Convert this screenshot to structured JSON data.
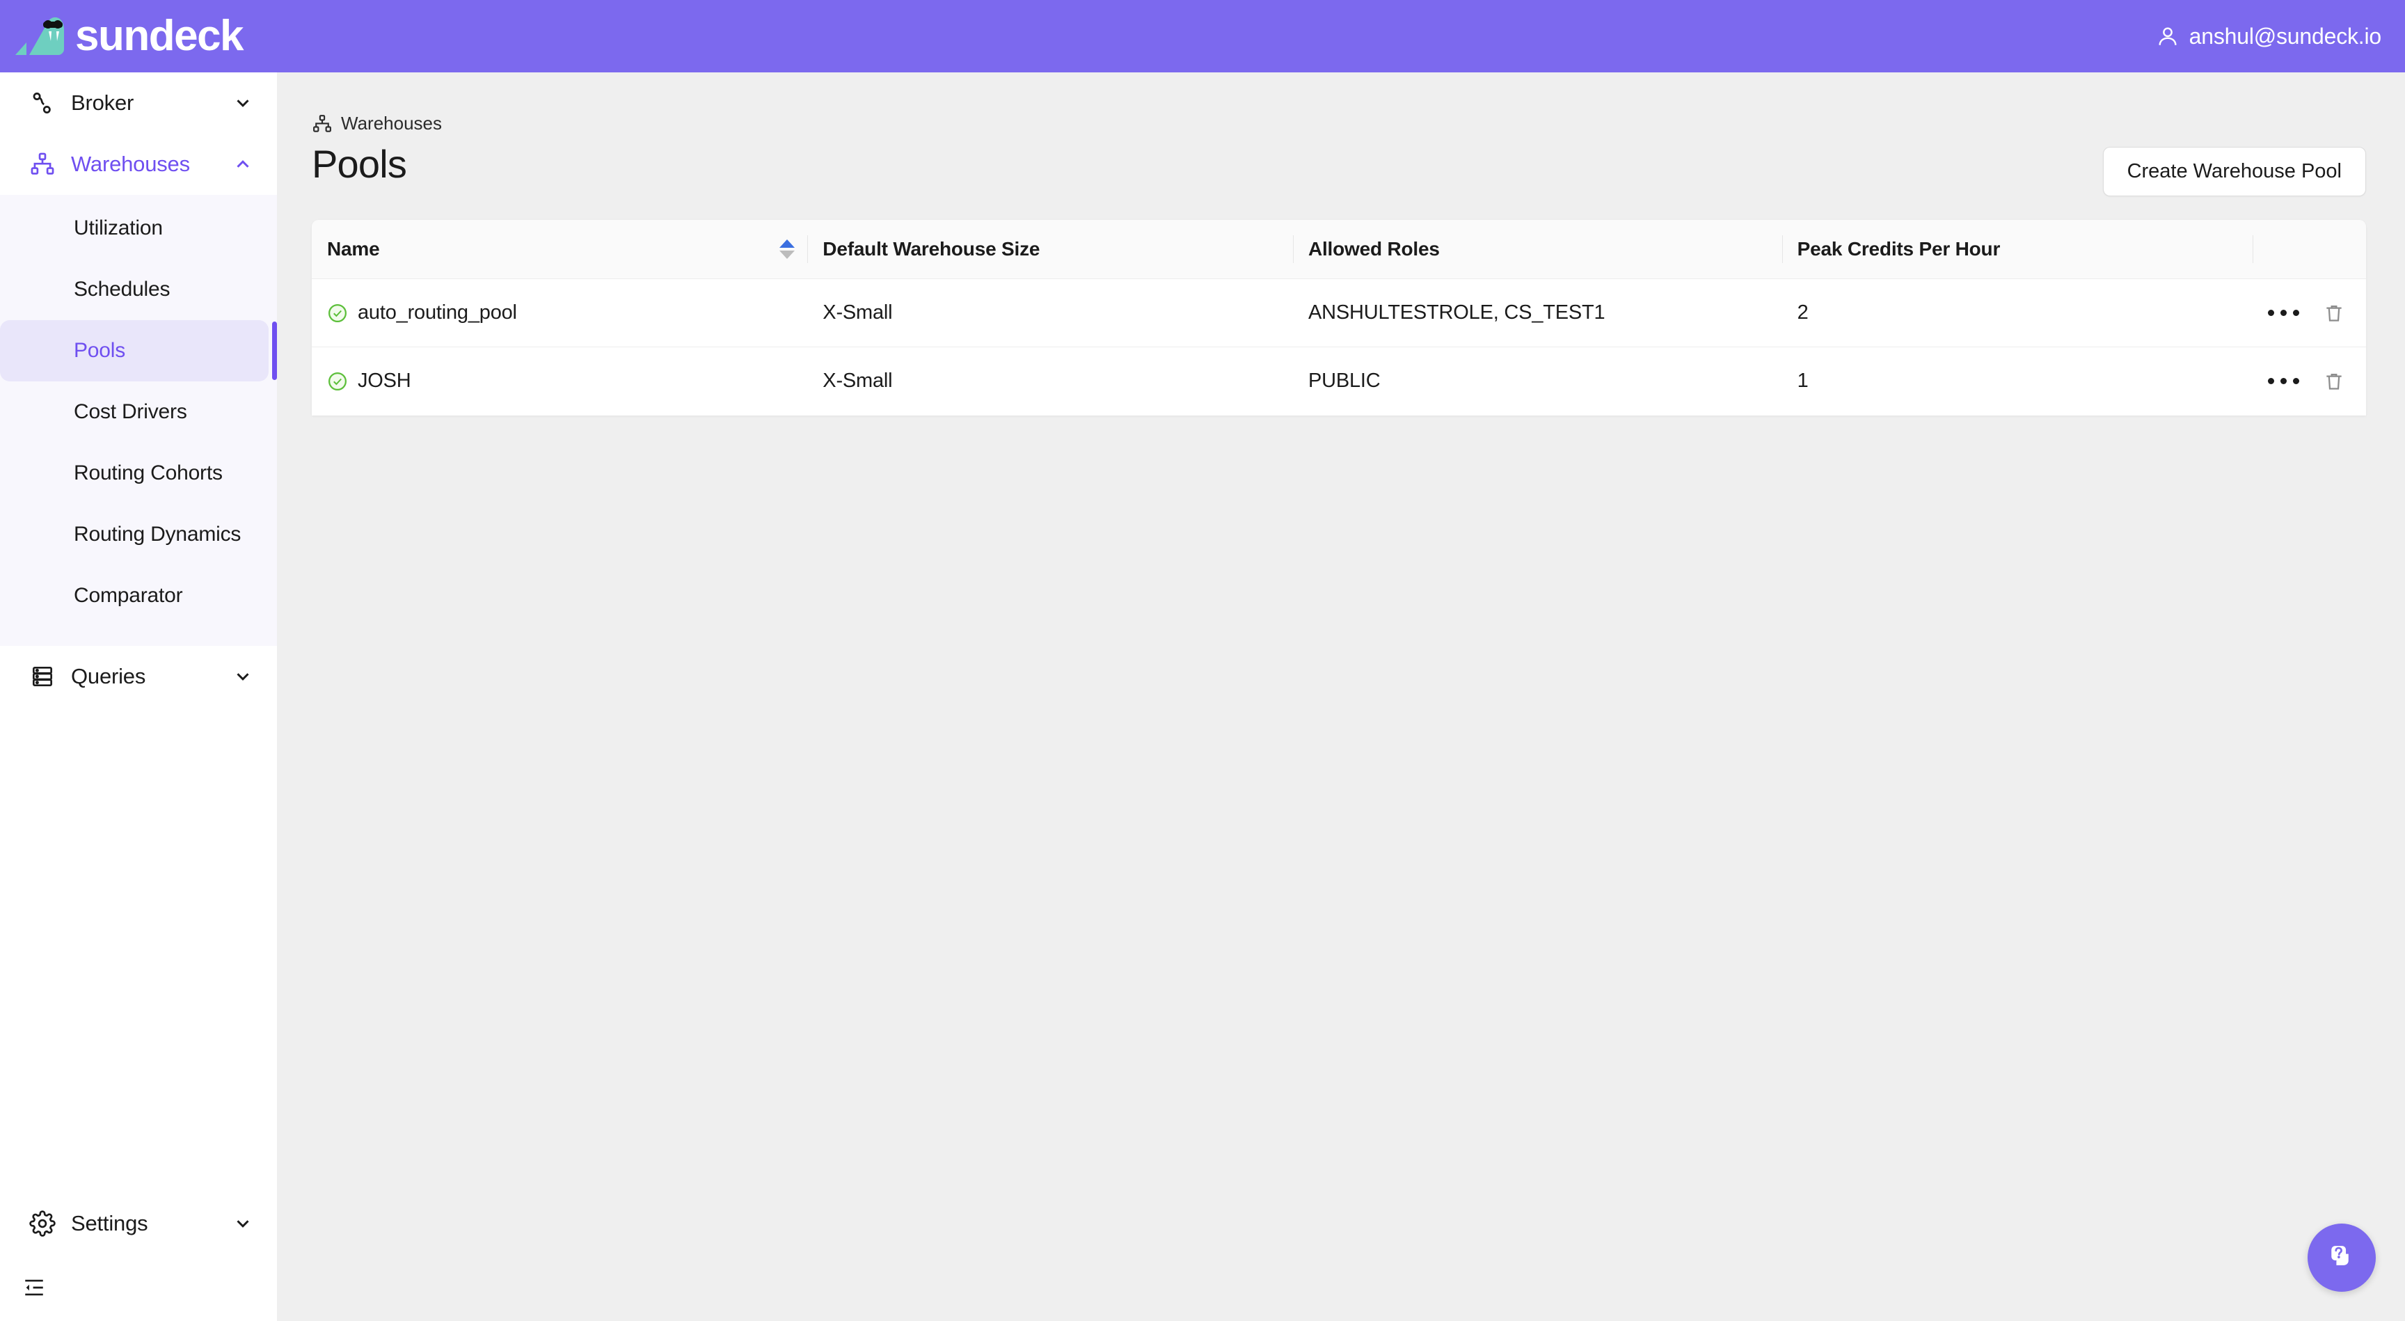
{
  "topbar": {
    "brand_name": "sundeck",
    "logo_icon": "walrus-sunglasses-logo",
    "user_icon": "person-icon",
    "user_email": "anshul@sundeck.io"
  },
  "sidebar": {
    "groups": [
      {
        "label": "Broker",
        "icon": "route-nodes-icon",
        "expanded": false,
        "active": false,
        "items": []
      },
      {
        "label": "Warehouses",
        "icon": "hierarchy-icon",
        "expanded": true,
        "active": true,
        "items": [
          {
            "label": "Utilization",
            "selected": false
          },
          {
            "label": "Schedules",
            "selected": false
          },
          {
            "label": "Pools",
            "selected": true
          },
          {
            "label": "Cost Drivers",
            "selected": false
          },
          {
            "label": "Routing Cohorts",
            "selected": false
          },
          {
            "label": "Routing Dynamics",
            "selected": false
          },
          {
            "label": "Comparator",
            "selected": false
          }
        ]
      },
      {
        "label": "Queries",
        "icon": "server-rack-icon",
        "expanded": false,
        "active": false,
        "items": []
      }
    ],
    "settings": {
      "label": "Settings",
      "icon": "gear-icon"
    },
    "collapse_icon": "collapse-sidebar-icon"
  },
  "main": {
    "breadcrumb": "Warehouses",
    "breadcrumb_icon": "hierarchy-icon",
    "page_title": "Pools",
    "create_button": "Create Warehouse Pool"
  },
  "table": {
    "columns": [
      {
        "label": "Name",
        "sorted": "asc"
      },
      {
        "label": "Default Warehouse Size",
        "sorted": null
      },
      {
        "label": "Allowed Roles",
        "sorted": null
      },
      {
        "label": "Peak Credits Per Hour",
        "sorted": null
      },
      {
        "label": "",
        "sorted": null
      }
    ],
    "rows": [
      {
        "status_icon": "check-circle-icon",
        "name": "auto_routing_pool",
        "default_warehouse_size": "X-Small",
        "allowed_roles": "ANSHULTESTROLE, CS_TEST1",
        "peak_credits_per_hour": "2",
        "more_icon": "ellipsis-icon",
        "delete_icon": "trash-icon"
      },
      {
        "status_icon": "check-circle-icon",
        "name": "JOSH",
        "default_warehouse_size": "X-Small",
        "allowed_roles": "PUBLIC",
        "peak_credits_per_hour": "1",
        "more_icon": "ellipsis-icon",
        "delete_icon": "trash-icon"
      }
    ]
  },
  "help_fab": {
    "icon": "help-card-question-icon"
  },
  "colors": {
    "brand_purple": "#7c69ee",
    "accent_purple": "#6f4ff0",
    "logo_teal": "#6ecfc0",
    "status_green": "#5cbf3a",
    "sort_active_blue": "#3b6fe0",
    "page_bg": "#efefef",
    "submenu_bg": "#f8f7fd"
  }
}
